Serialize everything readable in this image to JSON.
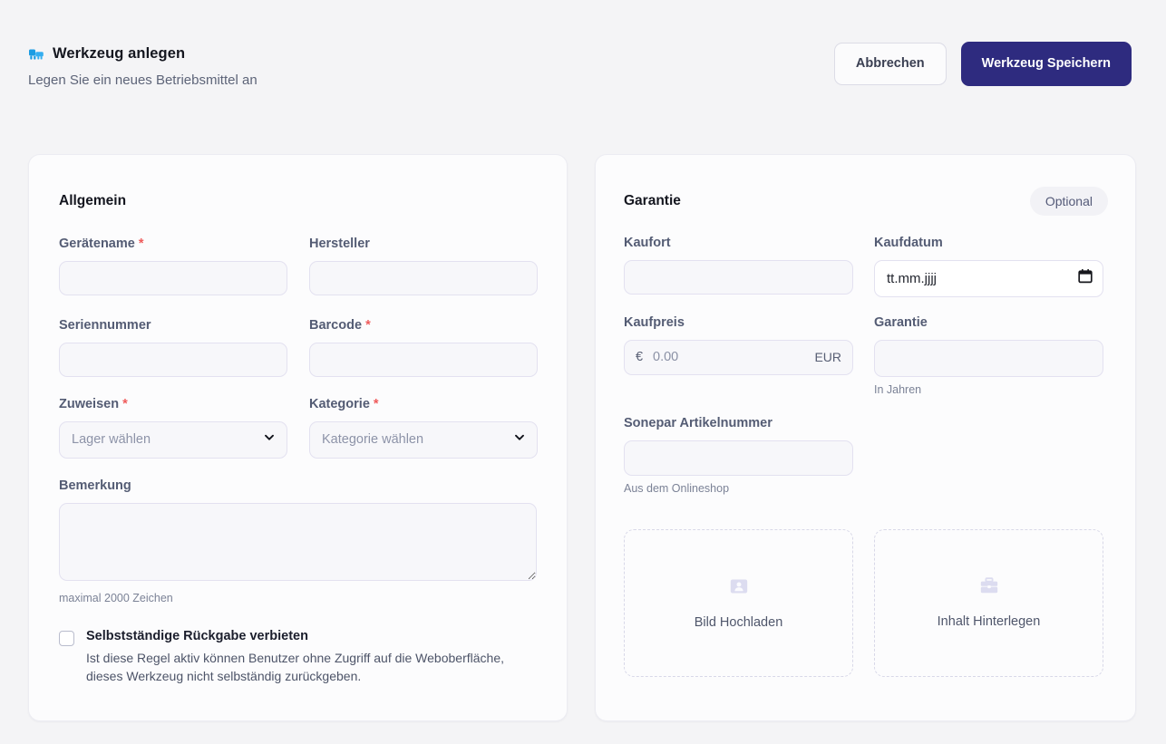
{
  "header": {
    "icon": "tool-icon",
    "title": "Werkzeug anlegen",
    "subtitle": "Legen Sie ein neues Betriebsmittel an",
    "cancel_label": "Abbrechen",
    "save_label": "Werkzeug Speichern",
    "accent_color": "#2e2b7f",
    "icon_color": "#1b9ce3"
  },
  "general": {
    "title": "Allgemein",
    "geraetename": {
      "label": "Gerätename",
      "required": "*",
      "value": "",
      "placeholder": ""
    },
    "hersteller": {
      "label": "Hersteller",
      "value": "",
      "placeholder": ""
    },
    "seriennummer": {
      "label": "Seriennummer",
      "value": "",
      "placeholder": ""
    },
    "barcode": {
      "label": "Barcode",
      "required": "*",
      "value": "",
      "placeholder": ""
    },
    "zuweisen": {
      "label": "Zuweisen",
      "required": "*",
      "selected": "Lager wählen"
    },
    "kategorie": {
      "label": "Kategorie",
      "required": "*",
      "selected": "Kategorie wählen"
    },
    "bemerkung": {
      "label": "Bemerkung",
      "value": "",
      "helper": "maximal 2000 Zeichen"
    },
    "rule": {
      "title": "Selbstständige Rückgabe verbieten",
      "description": "Ist diese Regel aktiv können Benutzer ohne Zugriff auf die Weboberfläche, dieses Werkzeug nicht selbständig zurückgeben.",
      "checked": false
    }
  },
  "warranty": {
    "title": "Garantie",
    "badge": "Optional",
    "kaufort": {
      "label": "Kaufort",
      "value": "",
      "placeholder": ""
    },
    "kaufdatum": {
      "label": "Kaufdatum",
      "value": "",
      "placeholder": "tt.mm.jjjj"
    },
    "kaufpreis": {
      "label": "Kaufpreis",
      "value": "",
      "placeholder": "0.00",
      "prefix": "€",
      "suffix": "EUR"
    },
    "garantie": {
      "label": "Garantie",
      "value": "",
      "helper": "In Jahren"
    },
    "sonepar": {
      "label": "Sonepar Artikelnummer",
      "value": "",
      "helper": "Aus dem Onlineshop"
    },
    "upload_image": {
      "label": "Bild Hochladen",
      "icon": "image-portrait-icon"
    },
    "upload_content": {
      "label": "Inhalt Hinterlegen",
      "icon": "briefcase-icon"
    }
  }
}
